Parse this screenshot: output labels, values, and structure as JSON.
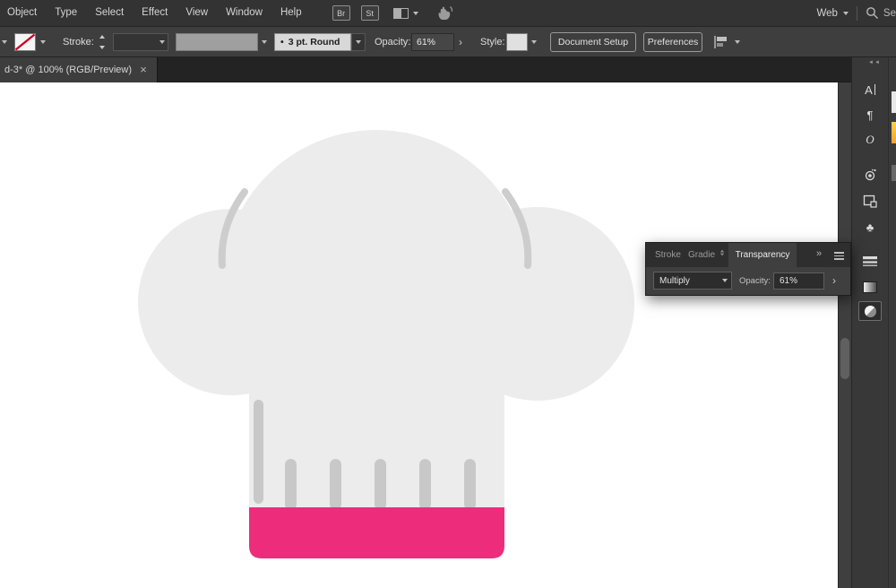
{
  "app": {
    "menubar": {
      "items": [
        "Object",
        "Type",
        "Select",
        "Effect",
        "View",
        "Window",
        "Help"
      ],
      "bridge_label": "Br",
      "stock_label": "St",
      "workspace_value": "Web",
      "search_partial": "Se"
    },
    "controlbar": {
      "stroke_label": "Stroke:",
      "brush_bullet": "•",
      "brush_name": "3 pt. Round",
      "opacity_label": "Opacity:",
      "opacity_value": "61%",
      "expand_glyph": "›",
      "style_label": "Style:",
      "document_setup_label": "Document Setup",
      "preferences_label": "Preferences"
    },
    "tabbar": {
      "document_title": "d-3* @ 100% (RGB/Preview)",
      "close_glyph": "×",
      "collapse_glyph": "◄◄"
    },
    "dock": {
      "character_glyph": "A",
      "paragraph_glyph": "¶",
      "opentype_glyph": "O",
      "symbols_glyph": "♣"
    },
    "transparency_panel": {
      "tab_stroke": "Stroke",
      "tab_gradient": "Gradie",
      "tab_transparency": "Transparency",
      "overflow_glyph": "»",
      "blend_mode_value": "Multiply",
      "opacity_label": "Opacity:",
      "opacity_value": "61%",
      "expand_glyph": "›"
    }
  },
  "artwork": {
    "description": "flat chef hat illustration",
    "colors": {
      "hat_fill": "#ececec",
      "hat_accent": "#cdcdcd",
      "pleat": "#c8c8c8",
      "band_pink": "#ee2c7c"
    }
  }
}
